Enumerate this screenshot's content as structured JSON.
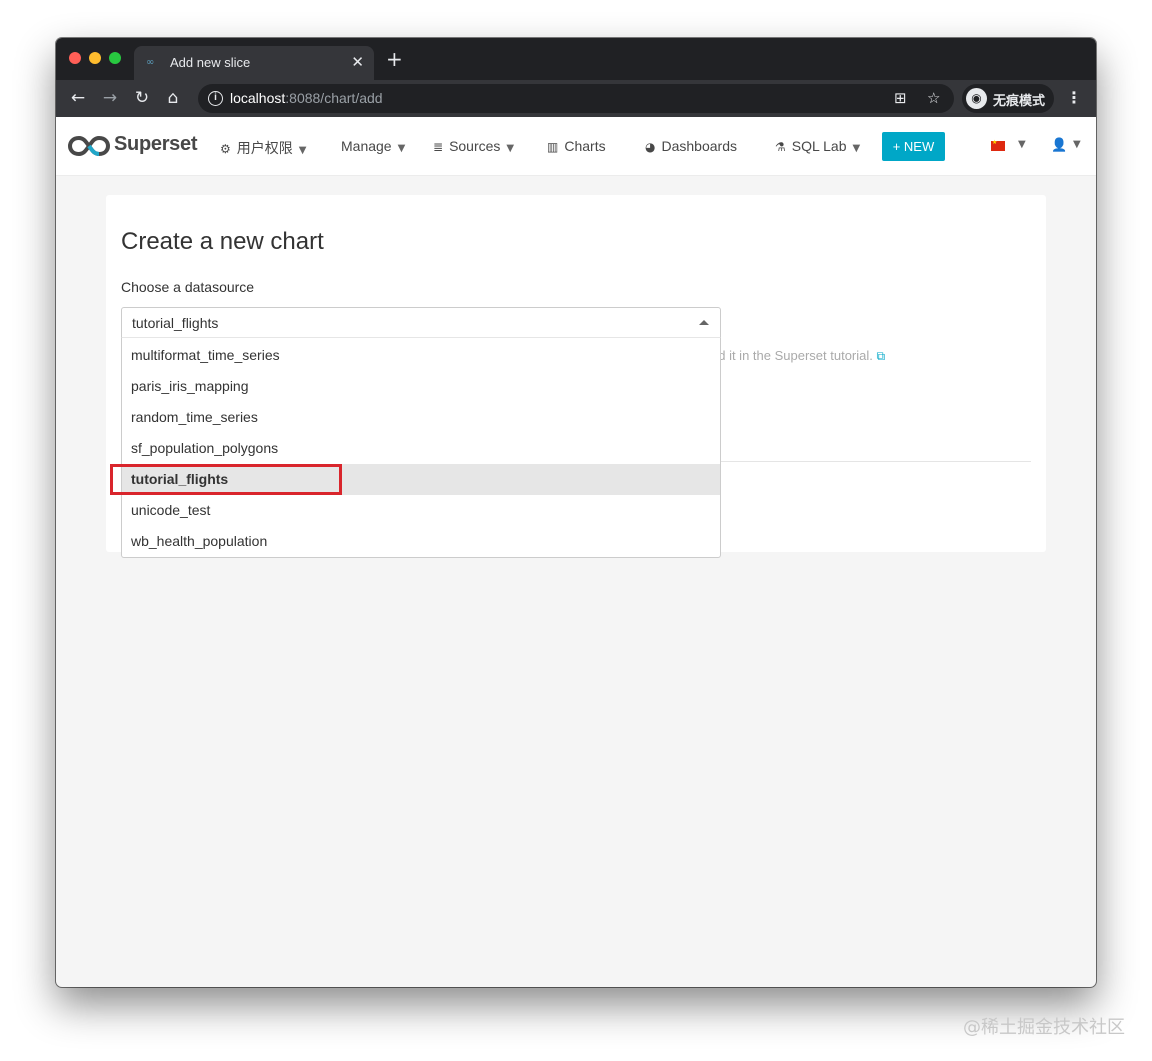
{
  "browser": {
    "tab_title": "Add new slice",
    "url_host": "localhost",
    "url_rest": ":8088/chart/add",
    "incognito_label": "无痕模式",
    "icons": [
      "back-icon",
      "forward-icon",
      "reload-icon",
      "home-icon",
      "info-icon",
      "translate-icon",
      "star-icon",
      "incognito-icon",
      "menu-icon"
    ]
  },
  "navbar": {
    "logo": "Superset",
    "items": [
      {
        "label": "用户权限",
        "icon": "gears-icon"
      },
      {
        "label": "Manage"
      },
      {
        "label": "Sources",
        "icon": "database-icon"
      },
      {
        "label": "Charts",
        "icon": "bar-chart-icon"
      },
      {
        "label": "Dashboards",
        "icon": "dashboard-icon"
      },
      {
        "label": "SQL Lab",
        "icon": "flask-icon"
      }
    ],
    "new_button": "+ NEW",
    "accent_color": "#00a7c7"
  },
  "panel": {
    "title": "Create a new chart",
    "datasource_label": "Choose a datasource",
    "selected_value": "tutorial_flights",
    "hint": "dd it in the Superset tutorial.",
    "options": [
      "multiformat_time_series",
      "paris_iris_mapping",
      "random_time_series",
      "sf_population_polygons",
      "tutorial_flights",
      "unicode_test",
      "wb_health_population"
    ],
    "focused_option": "tutorial_flights"
  },
  "annotation": {
    "highlight_color": "#d9252c"
  },
  "watermark": "@稀土掘金技术社区"
}
